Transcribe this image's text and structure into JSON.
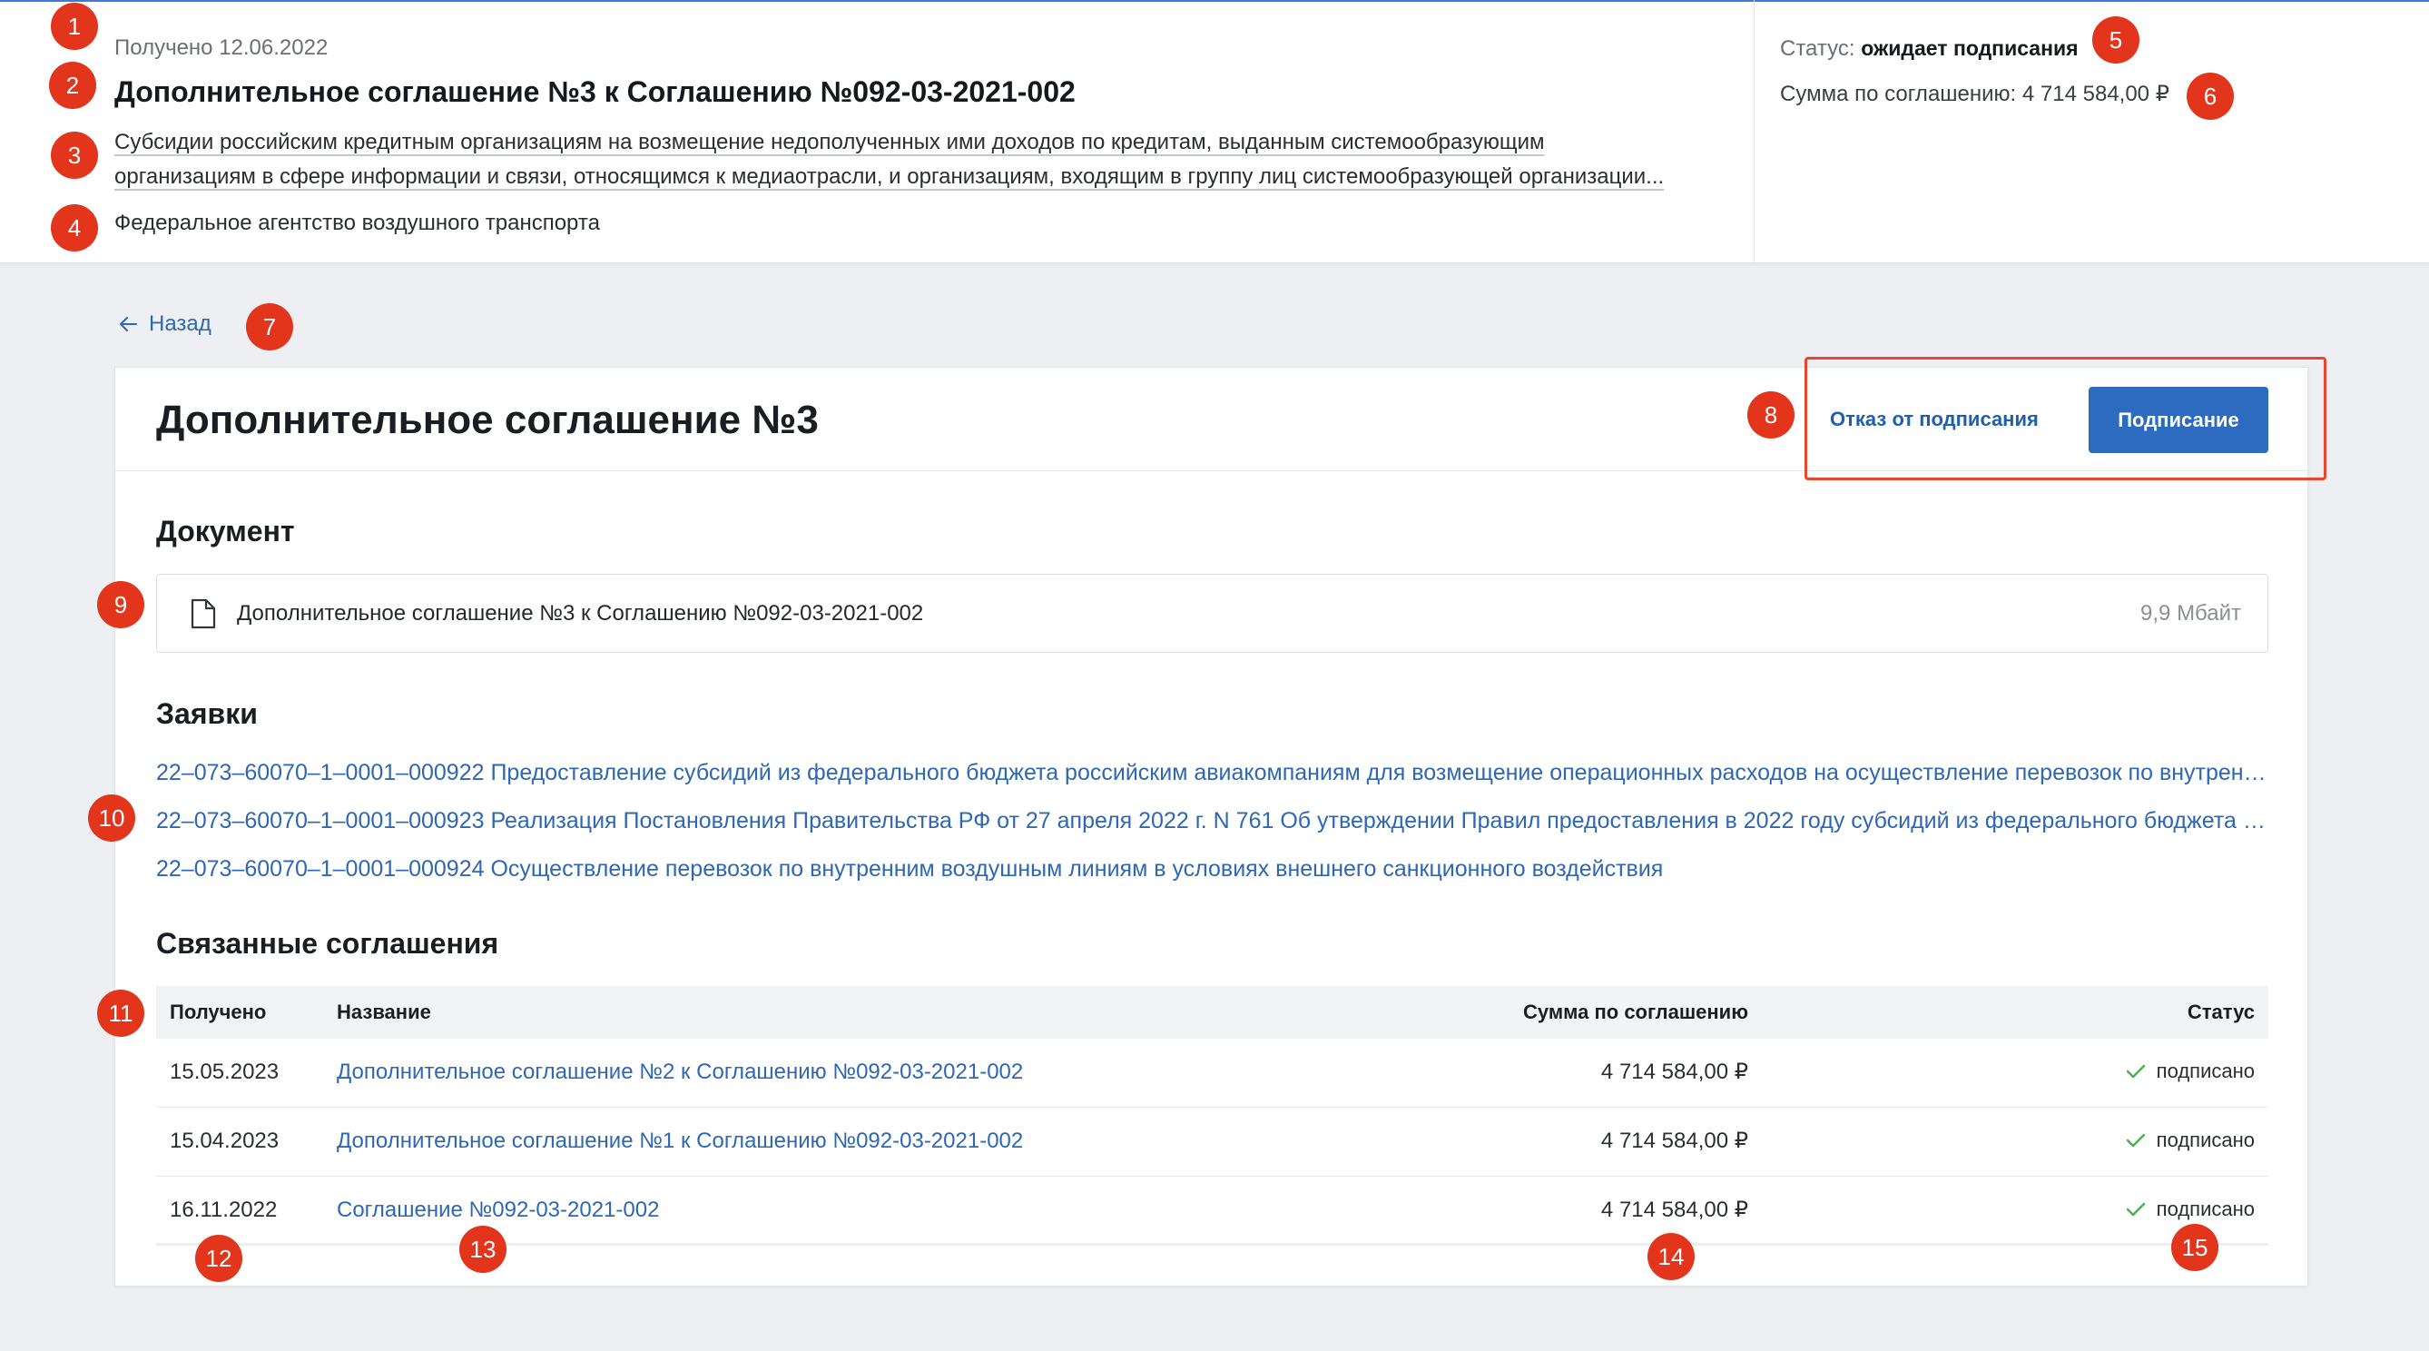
{
  "colors": {
    "accent": "#2f67b2",
    "button": "#2d6bc0",
    "annotation": "#e3341c",
    "success": "#4caf50",
    "page_background": "#edeff2"
  },
  "header": {
    "received": "Получено 12.06.2022",
    "title": "Дополнительное соглашение №3 к Соглашению №092-03-2021-002",
    "description_lines": [
      "Субсидии российским кредитным организациям на возмещение недополученных ими доходов по кредитам, выданным системообразующим",
      "организациям в сфере информации и связи, относящимся к медиаотрасли, и организациям, входящим в группу лиц системообразующей организации..."
    ],
    "agency": "Федеральное агентство воздушного транспорта",
    "status_label": "Статус:",
    "status_value": "ожидает подписания",
    "amount_label": "Сумма по соглашению:",
    "amount_value": "4 714 584,00 ₽"
  },
  "back": {
    "icon": "arrow-left-icon",
    "label": "Назад"
  },
  "card": {
    "title": "Дополнительное соглашение №3",
    "actions": {
      "reject_label": "Отказ от подписания",
      "sign_label": "Подписание"
    },
    "document_section": {
      "heading": "Документ",
      "icon": "file-icon",
      "name": "Дополнительное соглашение №3 к Соглашению №092-03-2021-002",
      "size": "9,9 Мбайт"
    },
    "applications_section": {
      "heading": "Заявки",
      "items": [
        "22–073–60070–1–0001–000922 Предоставление субсидий из федерального бюджета российским авиакомпаниям для возмещение операционных расходов на осуществление перевозок по внутренни...",
        "22–073–60070–1–0001–000923 Реализация Постановления Правительства РФ от 27 апреля 2022 г. N 761 Об утверждении Правил предоставления в 2022 году субсидий из федерального бюджета рос...",
        "22–073–60070–1–0001–000924 Осуществление перевозок по внутренним воздушным линиям в условиях внешнего санкционного воздействия"
      ]
    },
    "related_section": {
      "heading": "Связанные соглашения",
      "columns": [
        "Получено",
        "Название",
        "Сумма по соглашению",
        "Статус"
      ],
      "rows": [
        {
          "received": "15.05.2023",
          "name": "Дополнительное соглашение №2 к Соглашению №092-03-2021-002",
          "amount": "4 714 584,00 ₽",
          "status_icon": "check-icon",
          "status": "подписано"
        },
        {
          "received": "15.04.2023",
          "name": "Дополнительное соглашение №1 к Соглашению №092-03-2021-002",
          "amount": "4 714 584,00 ₽",
          "status_icon": "check-icon",
          "status": "подписано"
        },
        {
          "received": "16.11.2022",
          "name": "Соглашение №092-03-2021-002",
          "amount": "4 714 584,00 ₽",
          "status_icon": "check-icon",
          "status": "подписано"
        }
      ]
    }
  },
  "annotations": [
    "1",
    "2",
    "3",
    "4",
    "5",
    "6",
    "7",
    "8",
    "9",
    "10",
    "11",
    "12",
    "13",
    "14",
    "15"
  ]
}
